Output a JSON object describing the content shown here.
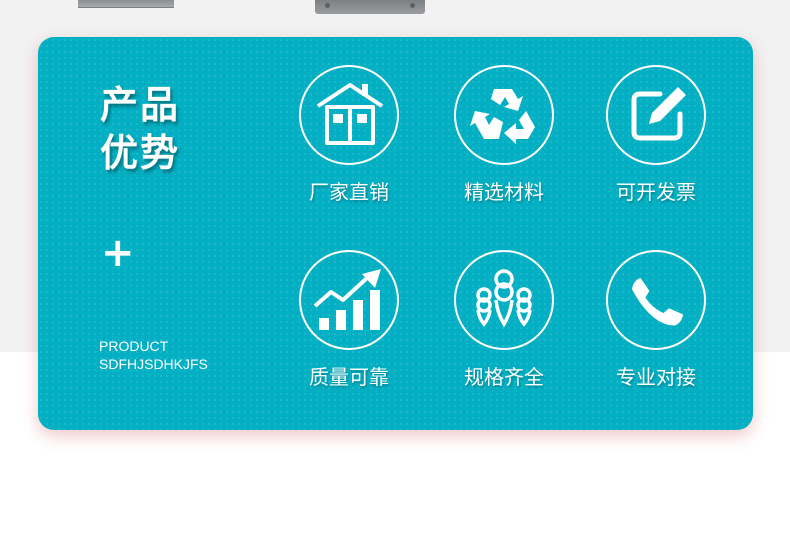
{
  "section": {
    "title_line1": "产品",
    "title_line2": "优势",
    "plus_symbol": "+",
    "subtitle_line1": "PRODUCT",
    "subtitle_line2": "SDFHJSDHKJFS"
  },
  "features": [
    {
      "label": "厂家直销",
      "icon": "house-icon"
    },
    {
      "label": "精选材料",
      "icon": "recycle-icon"
    },
    {
      "label": "可开发票",
      "icon": "edit-note-icon"
    },
    {
      "label": "质量可靠",
      "icon": "growth-chart-icon"
    },
    {
      "label": "规格齐全",
      "icon": "location-pins-icon"
    },
    {
      "label": "专业对接",
      "icon": "phone-icon"
    }
  ],
  "colors": {
    "card": "#03afc3",
    "text": "#ffffff",
    "page_top": "#f2f2f2",
    "page_bottom": "#ffffff"
  }
}
